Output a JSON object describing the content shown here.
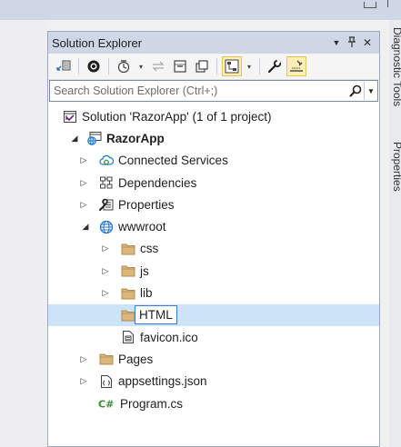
{
  "panel": {
    "title": "Solution Explorer",
    "search_placeholder": "Search Solution Explorer (Ctrl+;)"
  },
  "side_tabs": [
    "Diagnostic Tools",
    "Properties"
  ],
  "tree": {
    "solution": "Solution 'RazorApp' (1 of 1 project)",
    "project": "RazorApp",
    "connected_services": "Connected Services",
    "dependencies": "Dependencies",
    "properties": "Properties",
    "wwwroot": "wwwroot",
    "css": "css",
    "js": "js",
    "lib": "lib",
    "new_folder": "HTML",
    "favicon": "favicon.ico",
    "pages": "Pages",
    "appsettings": "appsettings.json",
    "program": "Program.cs"
  },
  "colors": {
    "title_bar": "#cfd6e5",
    "selection": "#cce4f7",
    "folder": "#dcb67a",
    "accent_blue": "#1e74c9"
  }
}
